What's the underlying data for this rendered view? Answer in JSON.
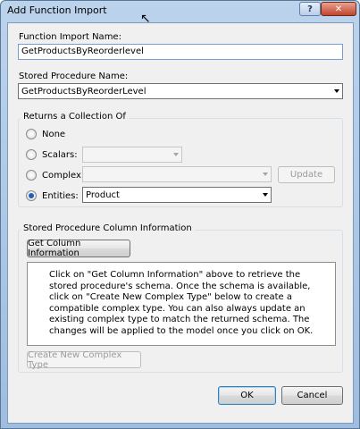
{
  "window": {
    "title": "Add Function Import",
    "help_label": "?",
    "close_label": "✕"
  },
  "function_import_name": {
    "label": "Function Import Name:",
    "value": "GetProductsByReorderlevel"
  },
  "stored_procedure": {
    "label": "Stored Procedure Name:",
    "selected": "GetProductsByReorderLevel"
  },
  "returns": {
    "group_title": "Returns a Collection Of",
    "options": {
      "none": "None",
      "scalars": "Scalars:",
      "complex": "Complex:",
      "entities": "Entities:"
    },
    "selected_option": "entities",
    "entities_value": "Product",
    "scalars_value": "",
    "complex_value": "",
    "update_label": "Update"
  },
  "column_info": {
    "group_title": "Stored Procedure Column Information",
    "get_button": "Get Column Information",
    "message": "Click on \"Get Column Information\" above to retrieve the stored procedure's schema. Once the schema is available, click on \"Create New Complex Type\" below to create a compatible complex type. You can also always update an existing complex type to match the returned schema. The changes will be applied to the model once you click on OK.",
    "create_button": "Create New Complex Type"
  },
  "footer": {
    "ok_label": "OK",
    "cancel_label": "Cancel"
  }
}
